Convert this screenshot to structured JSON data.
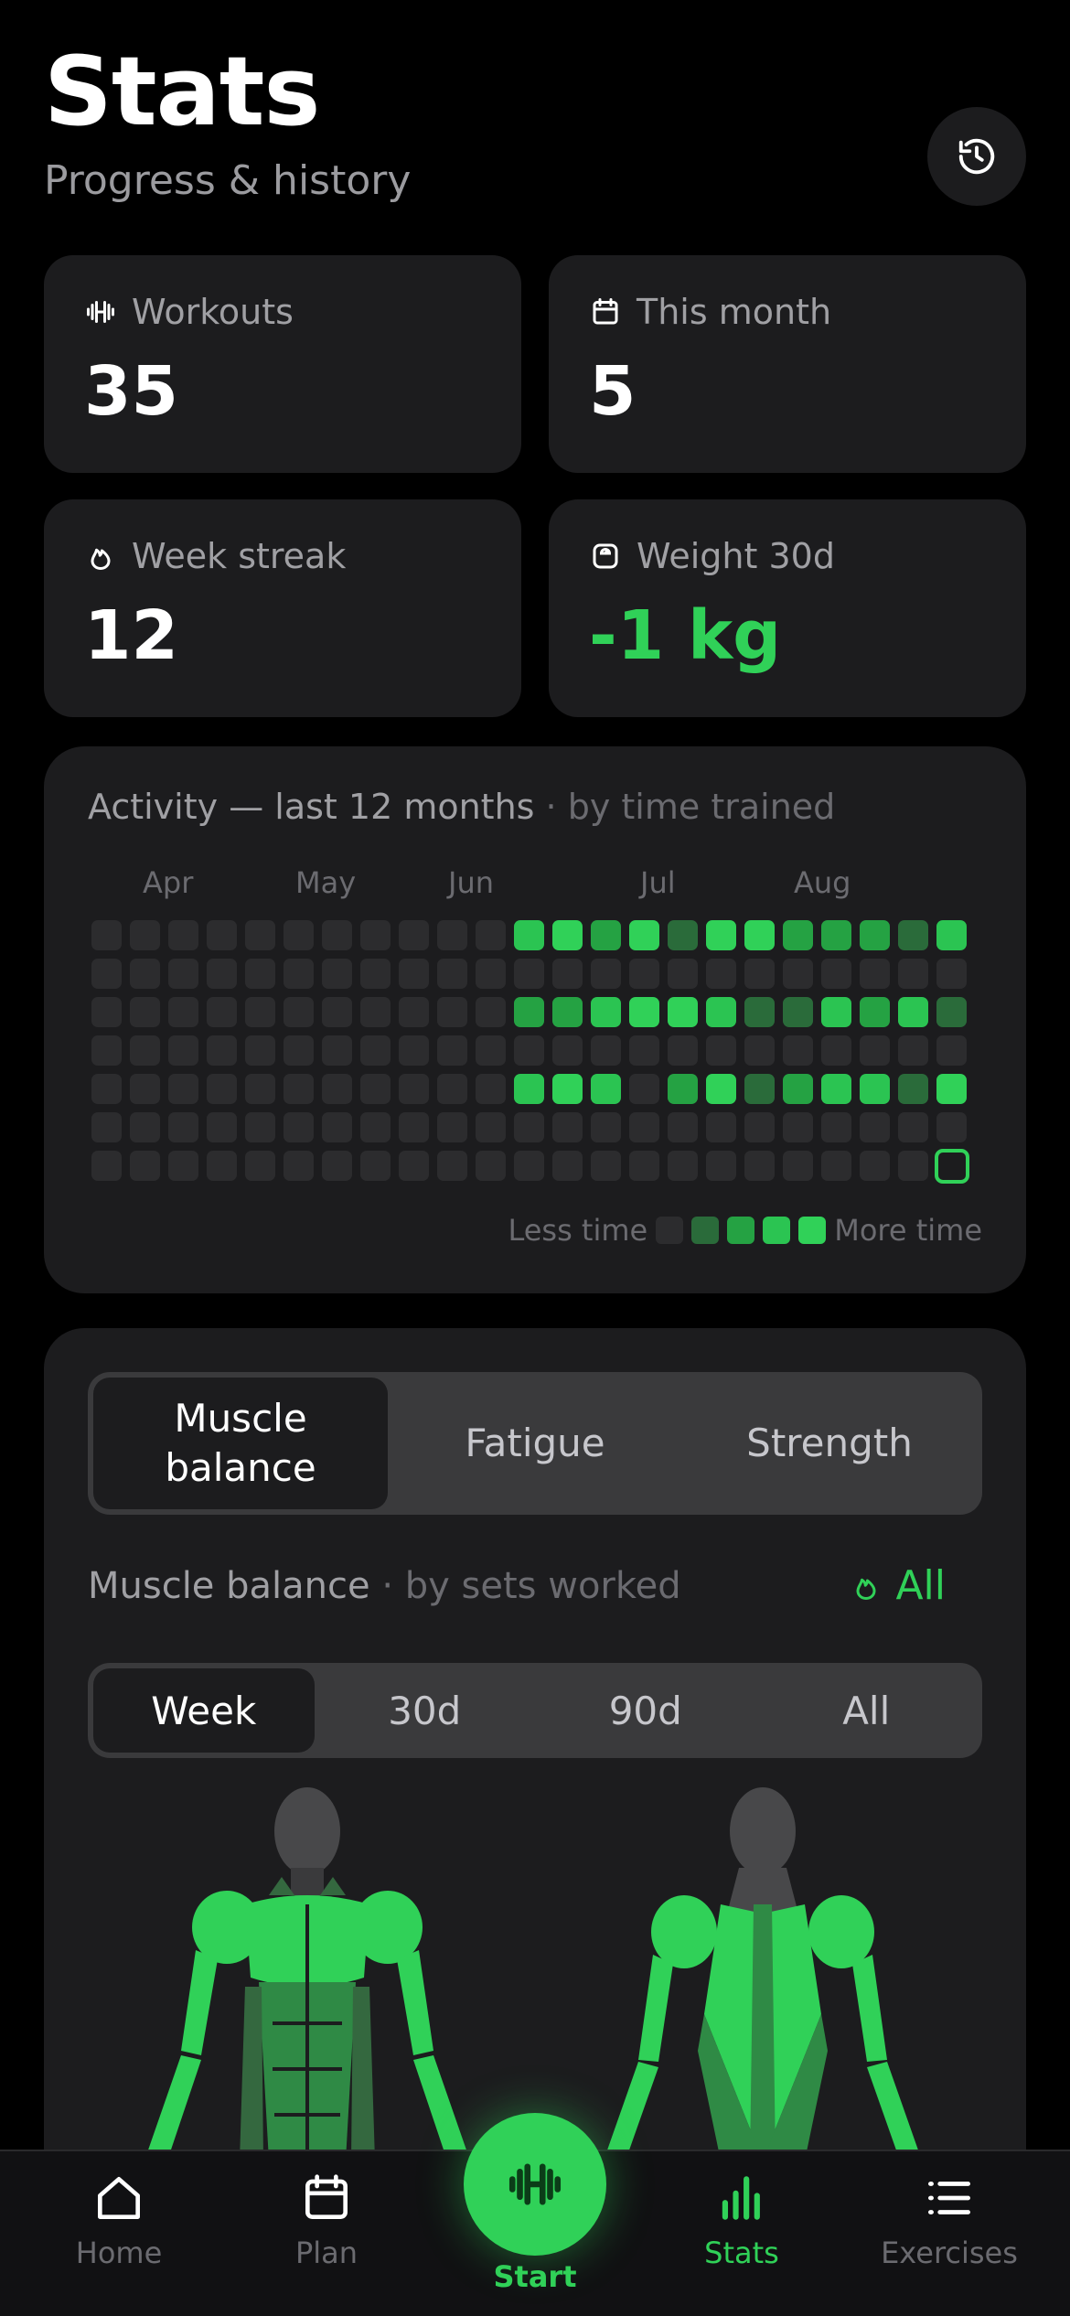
{
  "header": {
    "title": "Stats",
    "subtitle": "Progress & history",
    "history_icon": "history-icon"
  },
  "stats": [
    {
      "label": "Workouts",
      "value": "35",
      "icon": "dumbbell-icon"
    },
    {
      "label": "This month",
      "value": "5",
      "icon": "calendar-icon"
    },
    {
      "label": "Week streak",
      "value": "12",
      "icon": "flame-icon"
    },
    {
      "label": "Weight 30d",
      "value": "-1 kg",
      "icon": "scale-icon",
      "value_color": "#30d158"
    }
  ],
  "activity": {
    "title": "Activity — last 12 months",
    "subtitle": "· by time trained",
    "months": [
      "Apr",
      "May",
      "Jun",
      "Jul",
      "Aug"
    ],
    "legend_less": "Less time",
    "legend_more": "More time",
    "levels": [
      "#2c2c2e",
      "#2a6b3a",
      "#25a243",
      "#2bc452",
      "#30d158"
    ],
    "grid_rows": [
      [
        0,
        0,
        0,
        0,
        0,
        0,
        0,
        0,
        0,
        0,
        0,
        3,
        4,
        2,
        4,
        1,
        4,
        4,
        2,
        2,
        2,
        1,
        3
      ],
      [
        0,
        0,
        0,
        0,
        0,
        0,
        0,
        0,
        0,
        0,
        0,
        0,
        0,
        0,
        0,
        0,
        0,
        0,
        0,
        0,
        0,
        0,
        0
      ],
      [
        0,
        0,
        0,
        0,
        0,
        0,
        0,
        0,
        0,
        0,
        0,
        2,
        2,
        3,
        4,
        4,
        3,
        1,
        1,
        3,
        2,
        3,
        1
      ],
      [
        0,
        0,
        0,
        0,
        0,
        0,
        0,
        0,
        0,
        0,
        0,
        0,
        0,
        0,
        0,
        0,
        0,
        0,
        0,
        0,
        0,
        0,
        0
      ],
      [
        0,
        0,
        0,
        0,
        0,
        0,
        0,
        0,
        0,
        0,
        0,
        3,
        4,
        3,
        0,
        2,
        4,
        1,
        2,
        3,
        3,
        1,
        4
      ],
      [
        0,
        0,
        0,
        0,
        0,
        0,
        0,
        0,
        0,
        0,
        0,
        0,
        0,
        0,
        0,
        0,
        0,
        0,
        0,
        0,
        0,
        0,
        0
      ],
      [
        0,
        0,
        0,
        0,
        0,
        0,
        0,
        0,
        0,
        0,
        0,
        0,
        0,
        0,
        0,
        0,
        0,
        0,
        0,
        0,
        0,
        0,
        -1
      ]
    ]
  },
  "muscle": {
    "tabs": [
      {
        "label": "Muscle balance",
        "active": true
      },
      {
        "label": "Fatigue",
        "active": false
      },
      {
        "label": "Strength",
        "active": false
      }
    ],
    "title": "Muscle balance",
    "subtitle": "· by sets worked",
    "filter_label": "All",
    "ranges": [
      {
        "label": "Week",
        "active": true
      },
      {
        "label": "30d",
        "active": false
      },
      {
        "label": "90d",
        "active": false
      },
      {
        "label": "All",
        "active": false
      }
    ],
    "colors": {
      "high": "#30d158",
      "mid": "#2f8a45",
      "low": "#34683f",
      "body": "#48484a"
    }
  },
  "tabbar": {
    "items": [
      {
        "label": "Home",
        "icon": "home-icon"
      },
      {
        "label": "Plan",
        "icon": "calendar-icon"
      },
      {
        "label": "Start",
        "icon": "dumbbell-icon"
      },
      {
        "label": "Stats",
        "icon": "bar-chart-icon"
      },
      {
        "label": "Exercises",
        "icon": "list-icon"
      }
    ]
  },
  "accent": "#30d158"
}
